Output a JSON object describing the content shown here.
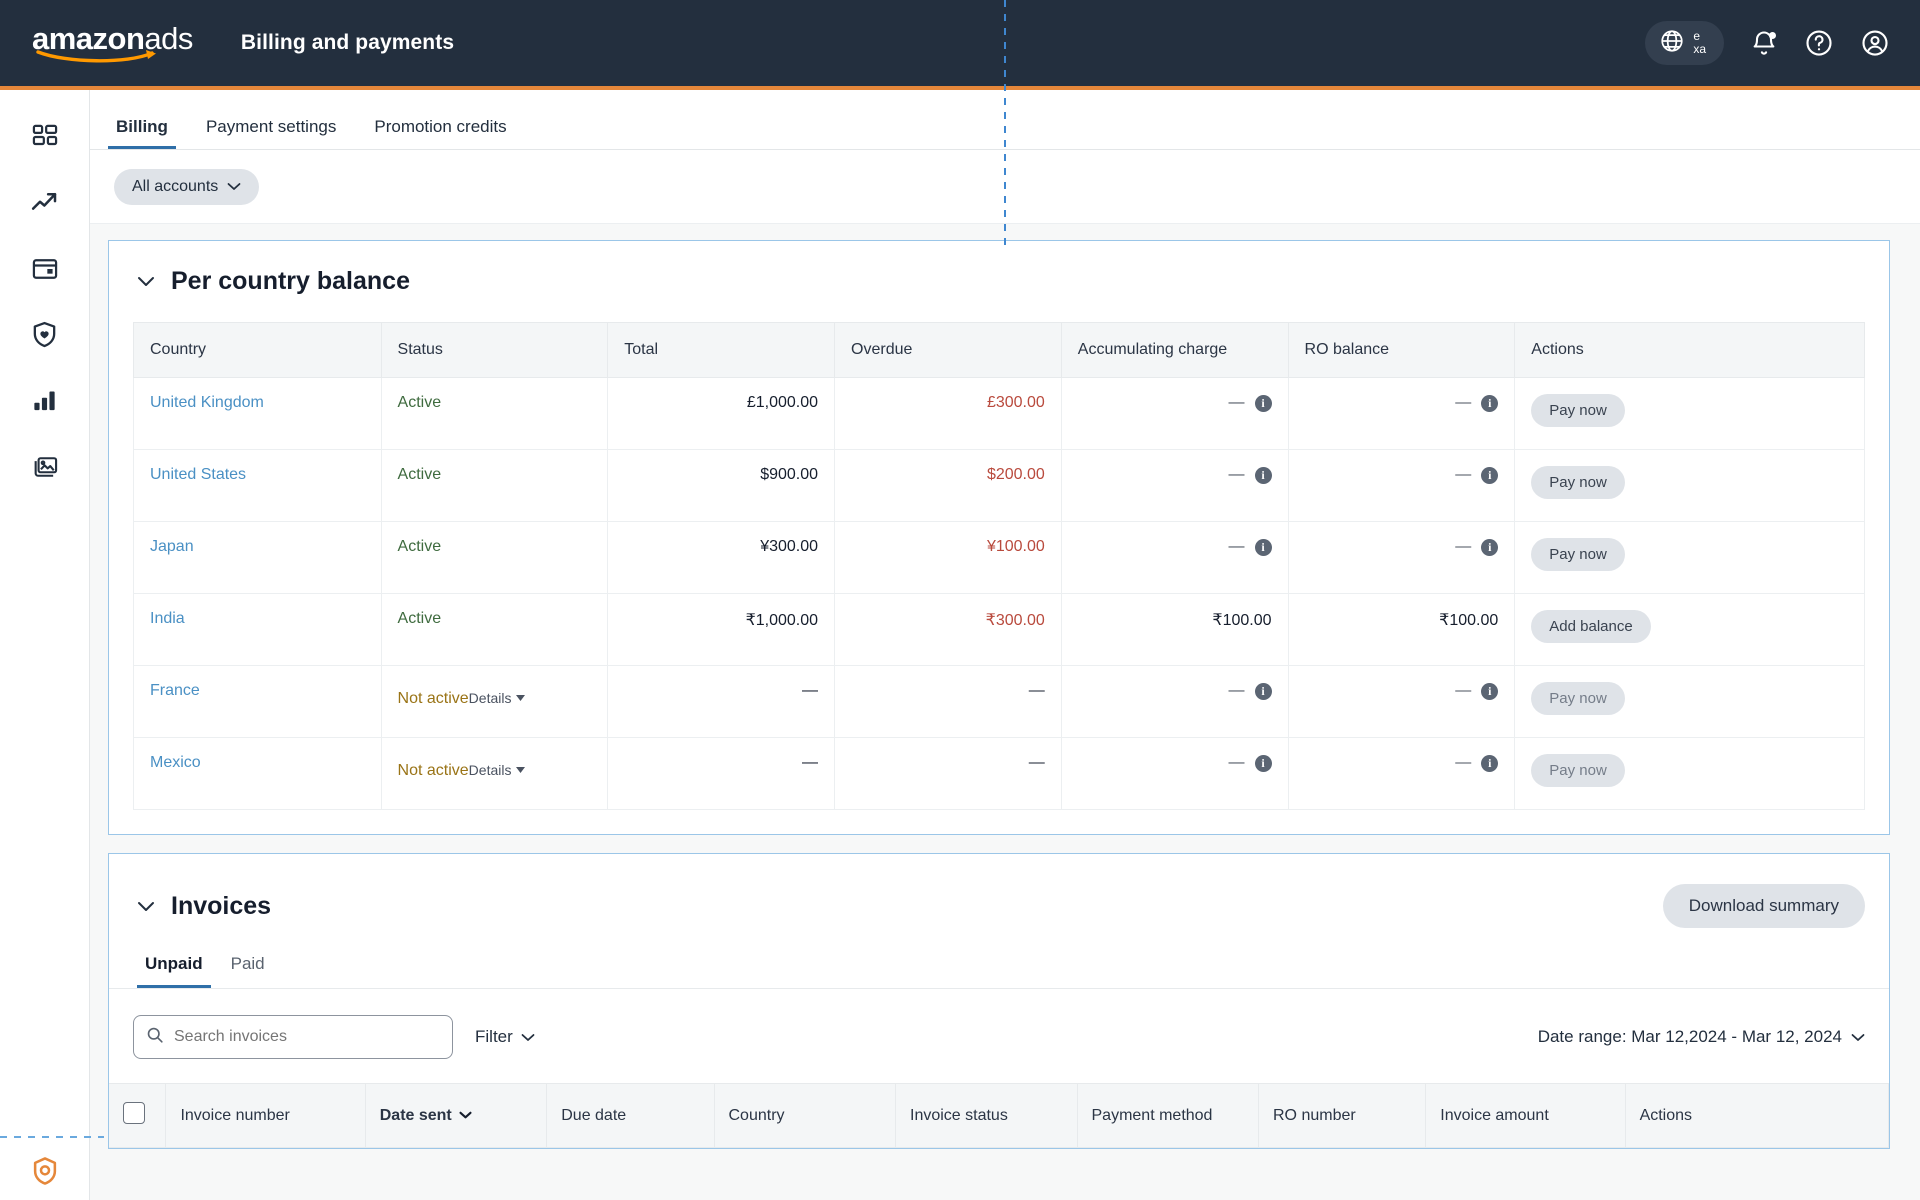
{
  "topbar": {
    "brand_bold": "amazon",
    "brand_light": "ads",
    "page_title": "Billing and payments",
    "lang_top": "e",
    "lang_bottom": "xa",
    "icons": [
      "globe-icon",
      "bell-icon",
      "help-icon",
      "account-icon"
    ]
  },
  "rail": {
    "items": [
      {
        "name": "dashboard-icon"
      },
      {
        "name": "trending-up-icon"
      },
      {
        "name": "billing-card-icon"
      },
      {
        "name": "shield-heart-icon"
      },
      {
        "name": "bar-chart-icon"
      },
      {
        "name": "media-library-icon"
      }
    ],
    "bottom": {
      "name": "settings-gear-icon"
    }
  },
  "tabs": [
    {
      "label": "Billing",
      "active": true
    },
    {
      "label": "Payment settings",
      "active": false
    },
    {
      "label": "Promotion credits",
      "active": false
    }
  ],
  "accounts_filter": {
    "label": "All accounts"
  },
  "balance_card": {
    "title": "Per country balance",
    "columns": [
      "Country",
      "Status",
      "Total",
      "Overdue",
      "Accumulating charge",
      "RO balance",
      "Actions"
    ],
    "rows": [
      {
        "country": "United Kingdom",
        "status": "Active",
        "status_kind": "active",
        "details": null,
        "total": "£1,000.00",
        "overdue": "£300.00",
        "accumulating": "—",
        "accumulating_info": true,
        "ro_balance": "—",
        "ro_info": true,
        "action": "Pay now",
        "action_dim": false
      },
      {
        "country": "United States",
        "status": "Active",
        "status_kind": "active",
        "details": null,
        "total": "$900.00",
        "overdue": "$200.00",
        "accumulating": "—",
        "accumulating_info": true,
        "ro_balance": "—",
        "ro_info": true,
        "action": "Pay now",
        "action_dim": false
      },
      {
        "country": "Japan",
        "status": "Active",
        "status_kind": "active",
        "details": null,
        "total": "¥300.00",
        "overdue": "¥100.00",
        "accumulating": "—",
        "accumulating_info": true,
        "ro_balance": "—",
        "ro_info": true,
        "action": "Pay now",
        "action_dim": false
      },
      {
        "country": "India",
        "status": "Active",
        "status_kind": "active",
        "details": null,
        "total": "₹1,000.00",
        "overdue": "₹300.00",
        "accumulating": "₹100.00",
        "accumulating_info": false,
        "ro_balance": "₹100.00",
        "ro_info": false,
        "action": "Add balance",
        "action_dim": false
      },
      {
        "country": "France",
        "status": "Not active",
        "status_kind": "inactive",
        "details": "Details",
        "total": "—",
        "overdue": "—",
        "accumulating": "—",
        "accumulating_info": true,
        "ro_balance": "—",
        "ro_info": true,
        "action": "Pay now",
        "action_dim": true
      },
      {
        "country": "Mexico",
        "status": "Not active",
        "status_kind": "inactive",
        "details": "Details",
        "total": "—",
        "overdue": "—",
        "accumulating": "—",
        "accumulating_info": true,
        "ro_balance": "—",
        "ro_info": true,
        "action": "Pay now",
        "action_dim": true
      }
    ]
  },
  "invoices_card": {
    "title": "Invoices",
    "download_label": "Download summary",
    "tabs": [
      {
        "label": "Unpaid",
        "active": true
      },
      {
        "label": "Paid",
        "active": false
      }
    ],
    "search_placeholder": "Search invoices",
    "search_value": "",
    "filter_label": "Filter",
    "date_range_label": "Date range: Mar 12,2024 - Mar 12, 2024",
    "columns": [
      "Invoice number",
      "Date sent",
      "Due date",
      "Country",
      "Invoice status",
      "Payment method",
      "RO number",
      "Invoice amount",
      "Actions"
    ],
    "sorted_column": "Date sent"
  },
  "colors": {
    "header_bg": "#232f3e",
    "accent_orange": "#e5873a",
    "link_blue": "#4a90c4",
    "overdue_red": "#b94a3d",
    "active_green": "#3f6b3f",
    "inactive_amber": "#9a7417",
    "tab_underline": "#2f6fa8",
    "card_border": "#9bc6e8"
  }
}
